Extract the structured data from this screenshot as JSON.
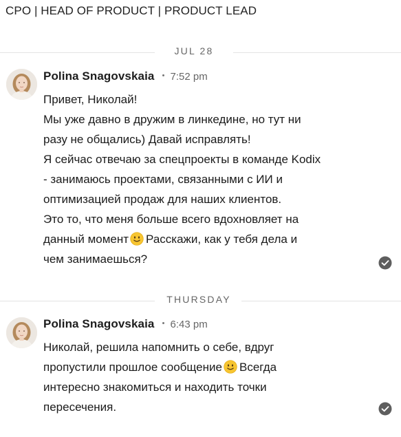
{
  "profile": {
    "headline": "CPO | HEAD OF PRODUCT | PRODUCT LEAD"
  },
  "conversation": {
    "groups": [
      {
        "date_label": "JUL 28",
        "message": {
          "sender": "Polina Snagovskaia",
          "time": "7:52 pm",
          "lines": {
            "l1": "Привет, Николай!",
            "l2": "Мы уже давно в дружим в линкедине, но тут ни",
            "l3": "разу не общались) Давай исправлять!",
            "l4": "Я сейчас отвечаю за спецпроекты в команде Kodix",
            "l5": "- занимаюсь проектами, связанными с ИИ и",
            "l6": "оптимизацией продаж для наших клиентов.",
            "l7": "Это то, что меня больше всего вдохновляет на",
            "l8a": "данный момент",
            "l8b": "Расскажи, как у тебя дела и",
            "l9": "чем занимаешься?"
          }
        }
      },
      {
        "date_label": "THURSDAY",
        "message": {
          "sender": "Polina Snagovskaia",
          "time": "6:43 pm",
          "lines": {
            "l1": "Николай, решила напомнить о себе, вдруг",
            "l2a": "пропустили прошлое сообщение",
            "l2b": "Всегда",
            "l3": "интересно знакомиться и находить точки",
            "l4": "пересечения."
          }
        }
      }
    ]
  },
  "icons": {
    "avatar": "sender-avatar-photo",
    "emoji": "slightly-smiling-face-emoji",
    "receipt": "read-check-circle-icon"
  },
  "colors": {
    "divider": "#e3e3e3",
    "muted_text": "#666666",
    "receipt": "#5e5e5e",
    "emoji_face": "#f7c531"
  }
}
